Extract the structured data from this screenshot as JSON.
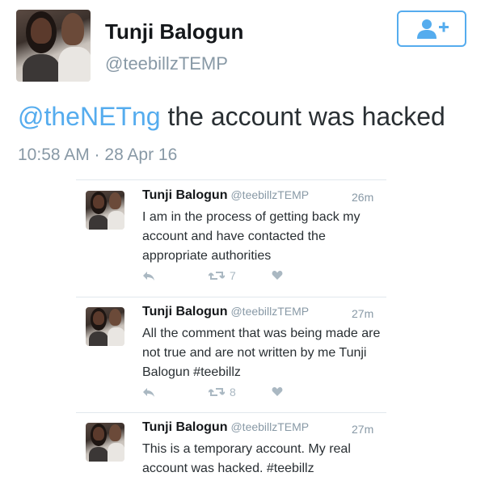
{
  "profile": {
    "name": "Tunji Balogun",
    "handle": "@teebillzTEMP"
  },
  "tweet": {
    "mention": "@theNETng",
    "text": " the account was hacked",
    "timestamp": "10:58 AM · 28 Apr 16"
  },
  "follow_button": {
    "icon": "add-user-icon",
    "color": "#55acee"
  },
  "replies": [
    {
      "name": "Tunji Balogun",
      "handle": "@teebillzTEMP",
      "time": "26m",
      "text": "I am in the process of getting back my account and have contacted the appropriate authorities",
      "retweets": "7"
    },
    {
      "name": "Tunji Balogun",
      "handle": "@teebillzTEMP",
      "time": "27m",
      "text": "All the comment that was being made are not true and are not written by me Tunji Balogun #teebillz",
      "retweets": "8"
    },
    {
      "name": "Tunji Balogun",
      "handle": "@teebillzTEMP",
      "time": "27m",
      "text": "This is a temporary account. My real account was hacked. #teebillz"
    }
  ]
}
